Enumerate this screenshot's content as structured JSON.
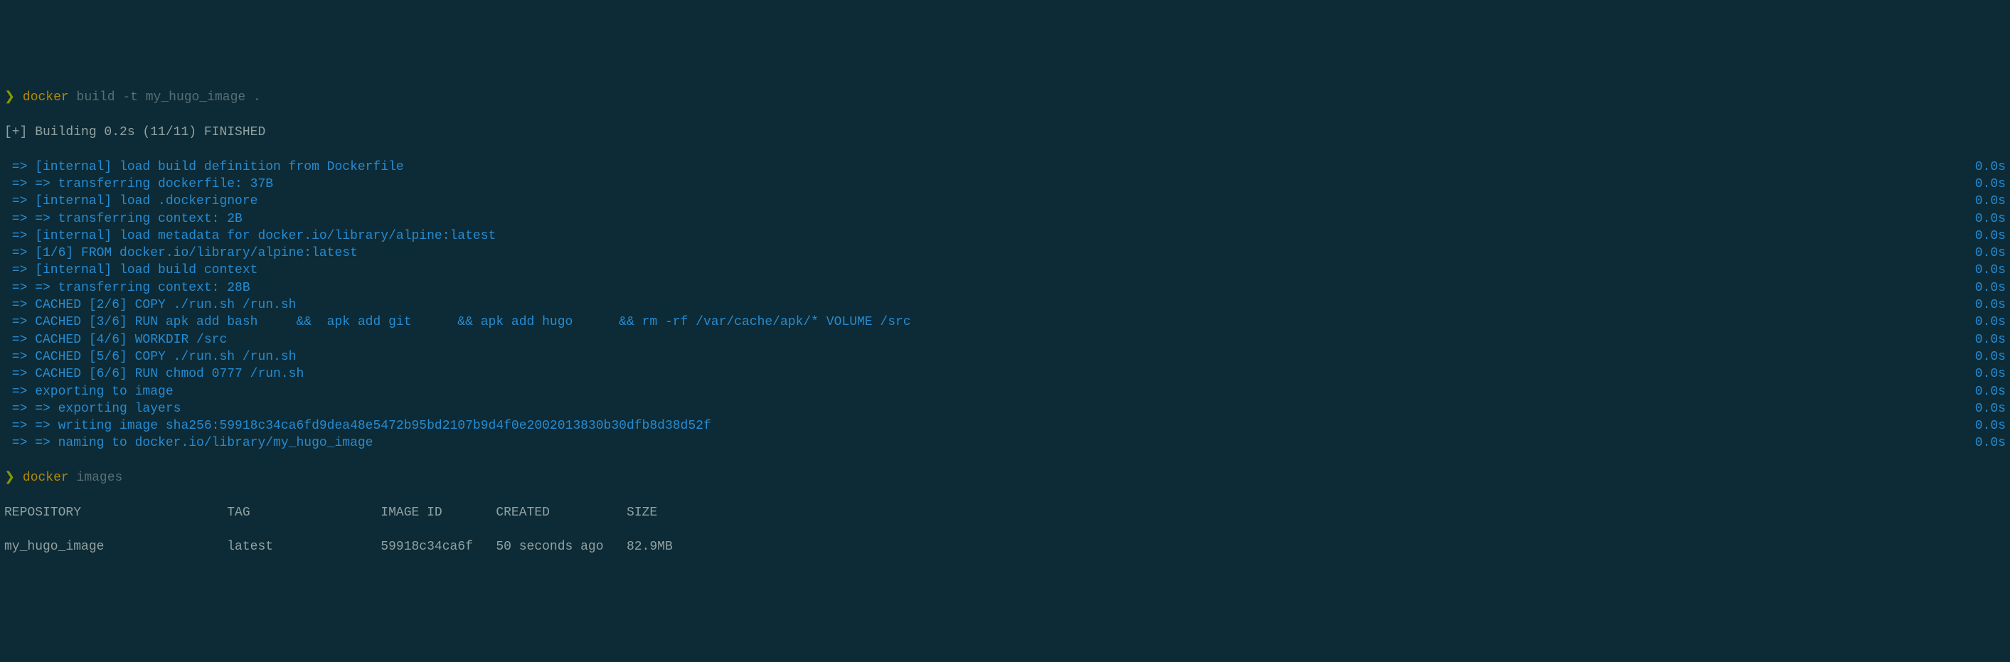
{
  "cmd1": {
    "caret": "❯",
    "program": "docker",
    "args": "build -t my_hugo_image ."
  },
  "build_header": "[+] Building 0.2s (11/11) FINISHED",
  "steps": [
    {
      "text": "=> [internal] load build definition from Dockerfile",
      "time": "0.0s"
    },
    {
      "text": "=> => transferring dockerfile: 37B",
      "time": "0.0s"
    },
    {
      "text": "=> [internal] load .dockerignore",
      "time": "0.0s"
    },
    {
      "text": "=> => transferring context: 2B",
      "time": "0.0s"
    },
    {
      "text": "=> [internal] load metadata for docker.io/library/alpine:latest",
      "time": "0.0s"
    },
    {
      "text": "=> [1/6] FROM docker.io/library/alpine:latest",
      "time": "0.0s"
    },
    {
      "text": "=> [internal] load build context",
      "time": "0.0s"
    },
    {
      "text": "=> => transferring context: 28B",
      "time": "0.0s"
    },
    {
      "text": "=> CACHED [2/6] COPY ./run.sh /run.sh",
      "time": "0.0s"
    },
    {
      "text": "=> CACHED [3/6] RUN apk add bash     &&  apk add git      && apk add hugo      && rm -rf /var/cache/apk/* VOLUME /src",
      "time": "0.0s"
    },
    {
      "text": "=> CACHED [4/6] WORKDIR /src",
      "time": "0.0s"
    },
    {
      "text": "=> CACHED [5/6] COPY ./run.sh /run.sh",
      "time": "0.0s"
    },
    {
      "text": "=> CACHED [6/6] RUN chmod 0777 /run.sh",
      "time": "0.0s"
    },
    {
      "text": "=> exporting to image",
      "time": "0.0s"
    },
    {
      "text": "=> => exporting layers",
      "time": "0.0s"
    },
    {
      "text": "=> => writing image sha256:59918c34ca6fd9dea48e5472b95bd2107b9d4f0e2002013830b30dfb8d38d52f",
      "time": "0.0s"
    },
    {
      "text": "=> => naming to docker.io/library/my_hugo_image",
      "time": "0.0s"
    }
  ],
  "cmd2": {
    "caret": "❯",
    "program": "docker",
    "args": "images"
  },
  "table": {
    "headers": {
      "repo": "REPOSITORY",
      "tag": "TAG",
      "image_id": "IMAGE ID",
      "created": "CREATED",
      "size": "SIZE"
    },
    "rows": [
      {
        "repo": "my_hugo_image",
        "tag": "latest",
        "image_id": "59918c34ca6f",
        "created": "50 seconds ago",
        "size": "82.9MB"
      }
    ]
  },
  "col_widths": {
    "repo": 29,
    "tag": 20,
    "image_id": 15,
    "created": 17,
    "size": 10
  }
}
